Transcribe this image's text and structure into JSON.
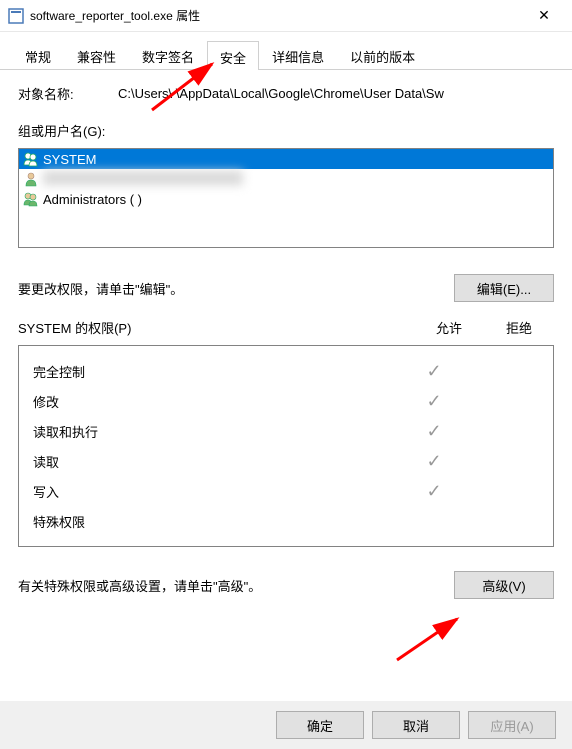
{
  "titlebar": {
    "text": "software_reporter_tool.exe 属性",
    "close": "✕"
  },
  "tabs": [
    {
      "label": "常规",
      "active": false
    },
    {
      "label": "兼容性",
      "active": false
    },
    {
      "label": "数字签名",
      "active": false
    },
    {
      "label": "安全",
      "active": true
    },
    {
      "label": "详细信息",
      "active": false
    },
    {
      "label": "以前的版本",
      "active": false
    }
  ],
  "object_name_label": "对象名称:",
  "object_path": "C:\\Users\\        \\AppData\\Local\\Google\\Chrome\\User Data\\Sw",
  "groups_label": "组或用户名(G):",
  "users": [
    {
      "name": "SYSTEM",
      "selected": true
    },
    {
      "name": "",
      "selected": false,
      "blurred": true
    },
    {
      "name": "Administrators (                                                    )",
      "selected": false
    }
  ],
  "edit_hint": "要更改权限，请单击\"编辑\"。",
  "edit_btn": "编辑(E)...",
  "perm_title": "SYSTEM 的权限(P)",
  "perm_allow": "允许",
  "perm_deny": "拒绝",
  "permissions": [
    {
      "name": "完全控制",
      "allow": true,
      "deny": false
    },
    {
      "name": "修改",
      "allow": true,
      "deny": false
    },
    {
      "name": "读取和执行",
      "allow": true,
      "deny": false
    },
    {
      "name": "读取",
      "allow": true,
      "deny": false
    },
    {
      "name": "写入",
      "allow": true,
      "deny": false
    },
    {
      "name": "特殊权限",
      "allow": false,
      "deny": false
    }
  ],
  "advanced_hint": "有关特殊权限或高级设置，请单击\"高级\"。",
  "advanced_btn": "高级(V)",
  "footer": {
    "ok": "确定",
    "cancel": "取消",
    "apply": "应用(A)"
  }
}
